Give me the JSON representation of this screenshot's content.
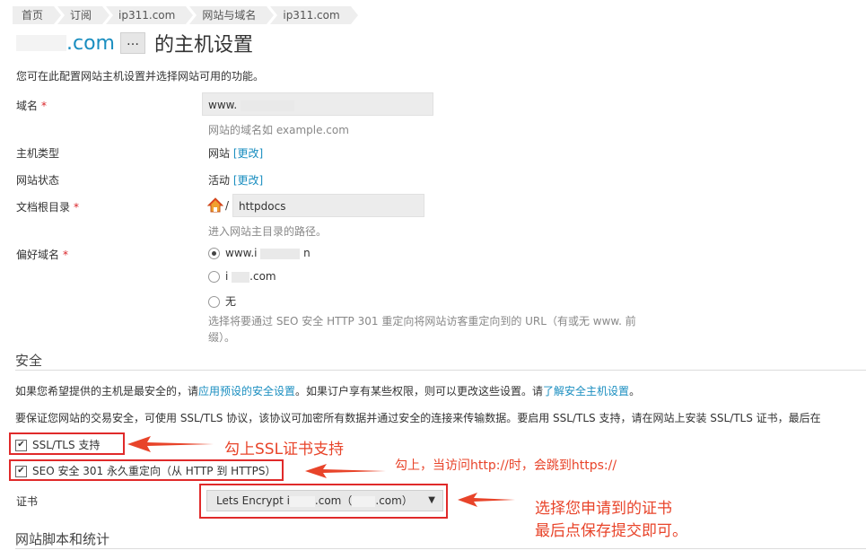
{
  "breadcrumb": [
    "首页",
    "订阅",
    "ip311.com",
    "网站与域名",
    "ip311.com"
  ],
  "title": {
    "domain": ".com",
    "more_label": "…",
    "heading": "的主机设置"
  },
  "description": "您可在此配置网站主机设置并选择网站可用的功能。",
  "fields": {
    "domain": {
      "label": "域名",
      "required": "*",
      "value": "www.",
      "hint": "网站的域名如 example.com"
    },
    "host_type": {
      "label": "主机类型",
      "value": "网站",
      "change": "[更改]"
    },
    "site_status": {
      "label": "网站状态",
      "value": "活动",
      "change": "[更改]"
    },
    "doc_root": {
      "label": "文档根目录",
      "required": "*",
      "prefix": "/",
      "value": "httpdocs",
      "hint": "进入网站主目录的路径。"
    },
    "preferred_domain": {
      "label": "偏好域名",
      "required": "*",
      "options": [
        "www.i",
        "n",
        "i",
        ".com",
        "无"
      ],
      "hint_line1": "选择将要通过 SEO 安全 HTTP 301 重定向将网站访客重定向到的 URL（有或无 www. 前",
      "hint_line2": "缀）。"
    }
  },
  "security": {
    "title": "安全",
    "para1_a": "如果您希望提供的主机是最安全的，请",
    "para1_link1": "应用预设的安全设置",
    "para1_b": "。如果订户享有某些权限，则可以更改这些设置。请",
    "para1_link2": "了解安全主机设置",
    "para1_c": "。",
    "para2": "要保证您网站的交易安全，可使用 SSL/TLS 协议，该协议可加密所有数据并通过安全的连接来传输数据。要启用 SSL/TLS 支持，请在网站上安装 SSL/TLS 证书，最后在",
    "ssl_checkbox": "SSL/TLS 支持",
    "seo_checkbox": "SEO 安全 301 永久重定向（从 HTTP 到 HTTPS）",
    "cert_label": "证书",
    "cert_value_a": "Lets Encrypt i",
    "cert_value_b": ".com（",
    "cert_value_c": ".com）",
    "dropdown_arrow": "▼"
  },
  "scripts_title": "网站脚本和统计",
  "annotations": {
    "ssl": "勾上SSL证书支持",
    "redirect": "勾上，当访问http://时，会跳到https://",
    "cert_line1": "选择您申请到的证书",
    "cert_line2": "最后点保存提交即可。"
  },
  "colors": {
    "link": "#1a8ec0",
    "required": "#d9252a",
    "annotation": "#e8442a",
    "highlight_box": "#e02a2a"
  },
  "icons": {
    "home": "home-icon",
    "check": "checkmark-icon",
    "arrow": "left-arrow-icon"
  }
}
